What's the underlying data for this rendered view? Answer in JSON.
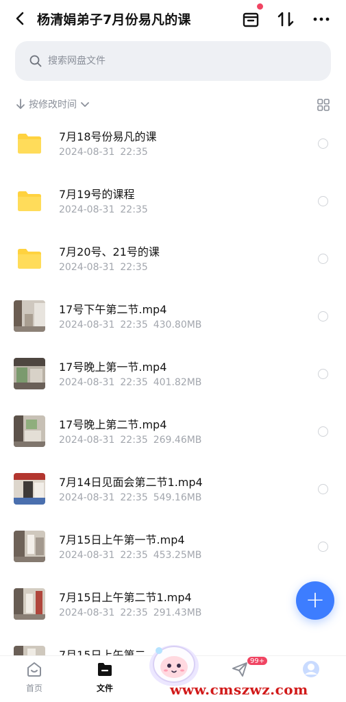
{
  "header": {
    "title": "杨清娟弟子7月份易凡的课"
  },
  "search": {
    "placeholder": "搜索网盘文件"
  },
  "sort": {
    "label": "按修改时间"
  },
  "files": [
    {
      "name": "7月18号份易凡的课",
      "date": "2024-08-31",
      "time": "22:35",
      "size": "",
      "type": "folder"
    },
    {
      "name": "7月19号的课程",
      "date": "2024-08-31",
      "time": "22:35",
      "size": "",
      "type": "folder"
    },
    {
      "name": "7月20号、21号的课",
      "date": "2024-08-31",
      "time": "22:35",
      "size": "",
      "type": "folder"
    },
    {
      "name": "17号下午第二节.mp4",
      "date": "2024-08-31",
      "time": "22:35",
      "size": "430.80MB",
      "type": "video"
    },
    {
      "name": "17号晚上第一节.mp4",
      "date": "2024-08-31",
      "time": "22:35",
      "size": "401.82MB",
      "type": "video"
    },
    {
      "name": "17号晚上第二节.mp4",
      "date": "2024-08-31",
      "time": "22:35",
      "size": "269.46MB",
      "type": "video"
    },
    {
      "name": "7月14日见面会第二节1.mp4",
      "date": "2024-08-31",
      "time": "22:35",
      "size": "549.16MB",
      "type": "video"
    },
    {
      "name": "7月15日上午第一节.mp4",
      "date": "2024-08-31",
      "time": "22:35",
      "size": "453.25MB",
      "type": "video"
    },
    {
      "name": "7月15日上午第二节1.mp4",
      "date": "2024-08-31",
      "time": "22:35",
      "size": "291.43MB",
      "type": "video"
    },
    {
      "name": "7月15日上午第二",
      "date": "",
      "time": "",
      "size": "",
      "type": "video"
    }
  ],
  "nav": {
    "home": "首页",
    "files": "文件",
    "badge": "99+"
  },
  "watermark": "www.cmszwz.com",
  "colors": {
    "accent": "#3d7dff",
    "folder": "#ffd23f",
    "badge": "#f04462",
    "watermark": "#d11a1a"
  }
}
